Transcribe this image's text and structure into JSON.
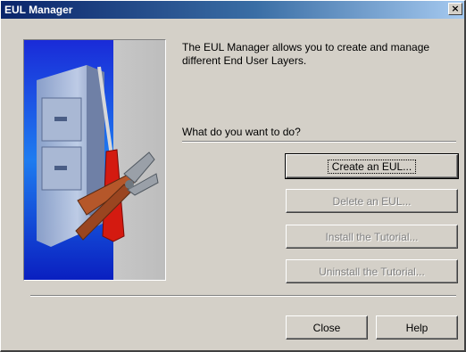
{
  "window": {
    "title": "EUL Manager",
    "close_glyph": "×"
  },
  "content": {
    "description": "The EUL Manager allows you to create and manage different End User Layers.",
    "question": "What do you want to do?"
  },
  "illustration": {
    "icon": "file-cabinet-tools-illustration"
  },
  "actions": [
    {
      "label": "Create an EUL...",
      "enabled": true,
      "default": true
    },
    {
      "label": "Delete an EUL...",
      "enabled": false
    },
    {
      "label": "Install the Tutorial...",
      "enabled": false
    },
    {
      "label": "Uninstall the Tutorial...",
      "enabled": false
    }
  ],
  "footer": {
    "close_label": "Close",
    "help_label": "Help"
  }
}
